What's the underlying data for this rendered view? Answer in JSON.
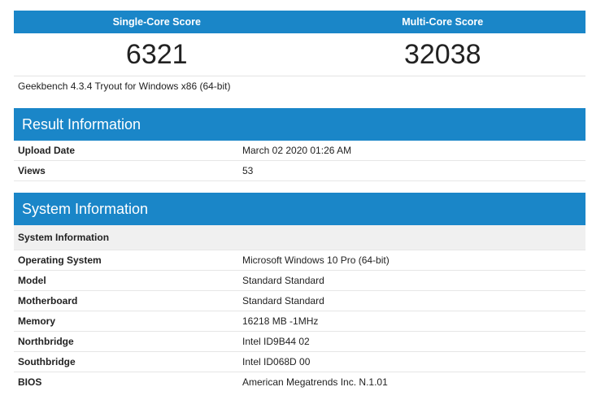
{
  "scores": {
    "single_label": "Single-Core Score",
    "multi_label": "Multi-Core Score",
    "single_value": "6321",
    "multi_value": "32038"
  },
  "version_text": "Geekbench 4.3.4 Tryout for Windows x86 (64-bit)",
  "result_info": {
    "title": "Result Information",
    "rows": [
      {
        "key": "Upload Date",
        "value": "March 02 2020 01:26 AM"
      },
      {
        "key": "Views",
        "value": "53"
      }
    ]
  },
  "system_info": {
    "title": "System Information",
    "subheading": "System Information",
    "rows": [
      {
        "key": "Operating System",
        "value": "Microsoft Windows 10 Pro (64-bit)"
      },
      {
        "key": "Model",
        "value": "Standard Standard"
      },
      {
        "key": "Motherboard",
        "value": "Standard Standard"
      },
      {
        "key": "Memory",
        "value": "16218 MB -1MHz"
      },
      {
        "key": "Northbridge",
        "value": "Intel ID9B44 02"
      },
      {
        "key": "Southbridge",
        "value": "Intel ID068D 00"
      },
      {
        "key": "BIOS",
        "value": "American Megatrends Inc. N.1.01"
      }
    ]
  },
  "colors": {
    "accent": "#1a86c8",
    "subheading_bg": "#f0f0f0"
  }
}
